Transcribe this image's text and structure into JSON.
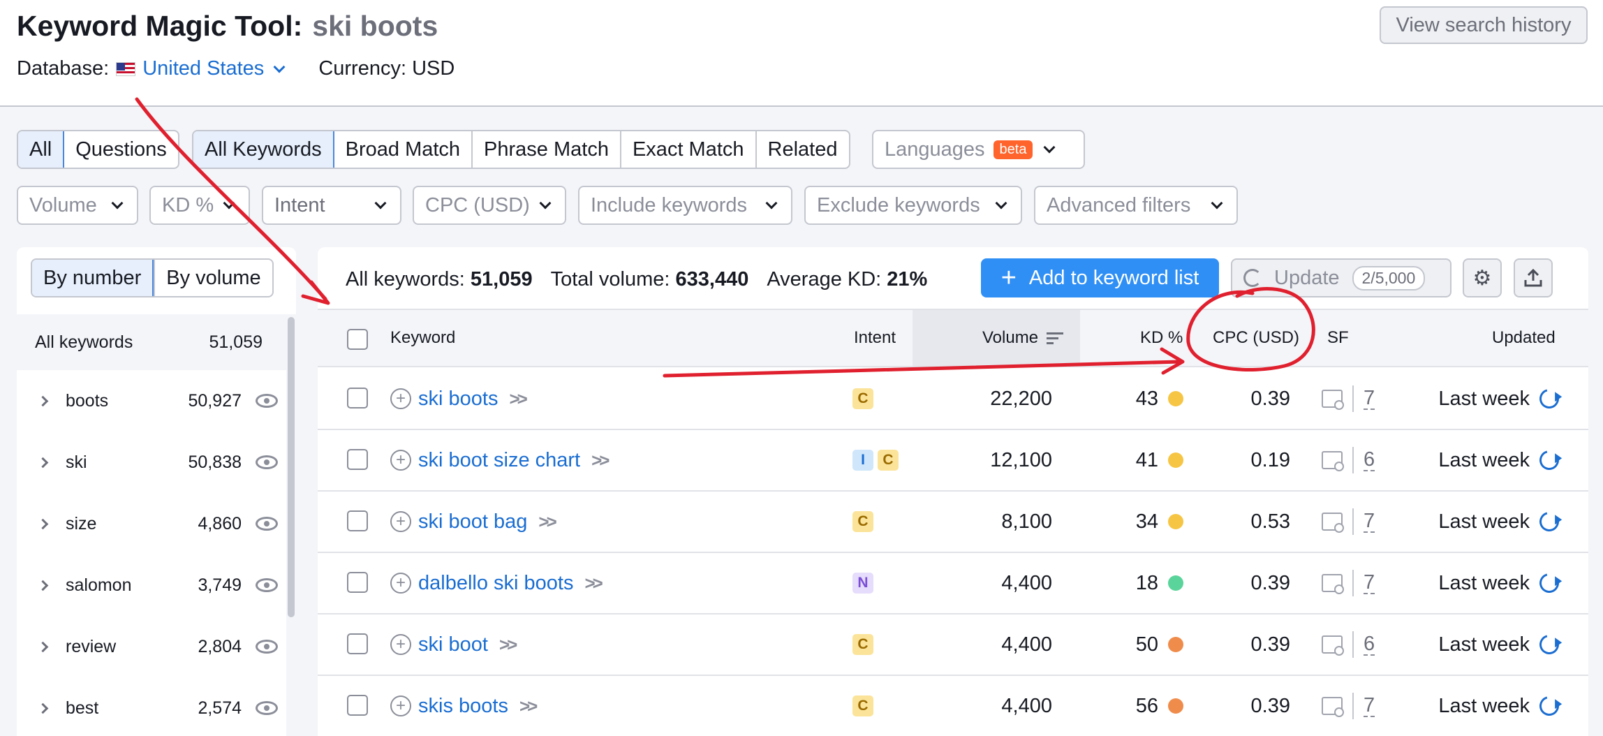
{
  "header": {
    "title": "Keyword Magic Tool:",
    "query": "ski boots",
    "view_history": "View search history",
    "database_label": "Database:",
    "database_value": "United States",
    "currency": "Currency: USD"
  },
  "match_tabs": {
    "type": [
      "All",
      "Questions"
    ],
    "match": [
      "All Keywords",
      "Broad Match",
      "Phrase Match",
      "Exact Match",
      "Related"
    ],
    "languages": "Languages",
    "beta": "beta"
  },
  "filters": [
    "Volume",
    "KD %",
    "Intent",
    "CPC (USD)",
    "Include keywords",
    "Exclude keywords",
    "Advanced filters"
  ],
  "groups": {
    "sort": [
      "By number",
      "By volume"
    ],
    "all_label": "All keywords",
    "all_count": "51,059",
    "items": [
      {
        "name": "boots",
        "count": "50,927"
      },
      {
        "name": "ski",
        "count": "50,838"
      },
      {
        "name": "size",
        "count": "4,860"
      },
      {
        "name": "salomon",
        "count": "3,749"
      },
      {
        "name": "review",
        "count": "2,804"
      },
      {
        "name": "best",
        "count": "2,574"
      }
    ]
  },
  "summary": {
    "all_keywords_label": "All keywords:",
    "all_keywords_value": "51,059",
    "total_volume_label": "Total volume:",
    "total_volume_value": "633,440",
    "avg_kd_label": "Average KD:",
    "avg_kd_value": "21%"
  },
  "toolbar": {
    "add_label": "Add to keyword list",
    "update_label": "Update",
    "quota": "2/5,000"
  },
  "table": {
    "columns": {
      "keyword": "Keyword",
      "intent": "Intent",
      "volume": "Volume",
      "kd": "KD %",
      "cpc": "CPC (USD)",
      "sf": "SF",
      "updated": "Updated"
    },
    "rows": [
      {
        "keyword": "ski boots",
        "intents": [
          "C"
        ],
        "volume": "22,200",
        "kd": "43",
        "kd_color": "#f7c544",
        "cpc": "0.39",
        "sf": "7",
        "updated": "Last week"
      },
      {
        "keyword": "ski boot size chart",
        "intents": [
          "I",
          "C"
        ],
        "volume": "12,100",
        "kd": "41",
        "kd_color": "#f7c544",
        "cpc": "0.19",
        "sf": "6",
        "updated": "Last week"
      },
      {
        "keyword": "ski boot bag",
        "intents": [
          "C"
        ],
        "volume": "8,100",
        "kd": "34",
        "kd_color": "#f7c544",
        "cpc": "0.53",
        "sf": "7",
        "updated": "Last week"
      },
      {
        "keyword": "dalbello ski boots",
        "intents": [
          "N"
        ],
        "volume": "4,400",
        "kd": "18",
        "kd_color": "#5ad49a",
        "cpc": "0.39",
        "sf": "7",
        "updated": "Last week"
      },
      {
        "keyword": "ski boot",
        "intents": [
          "C"
        ],
        "volume": "4,400",
        "kd": "50",
        "kd_color": "#f08c4b",
        "cpc": "0.39",
        "sf": "6",
        "updated": "Last week"
      },
      {
        "keyword": "skis boots",
        "intents": [
          "C"
        ],
        "volume": "4,400",
        "kd": "56",
        "kd_color": "#f08c4b",
        "cpc": "0.39",
        "sf": "7",
        "updated": "Last week"
      }
    ]
  },
  "intent_styles": {
    "C": {
      "bg": "#fbe49a",
      "fg": "#9a6a00"
    },
    "I": {
      "bg": "#cfe6fb",
      "fg": "#1a6dd1"
    },
    "N": {
      "bg": "#e6dcfb",
      "fg": "#7a4fd6"
    }
  },
  "colors": {
    "accent": "#2f8ff5",
    "link": "#1a6dd1",
    "annotation": "#e0202e"
  }
}
